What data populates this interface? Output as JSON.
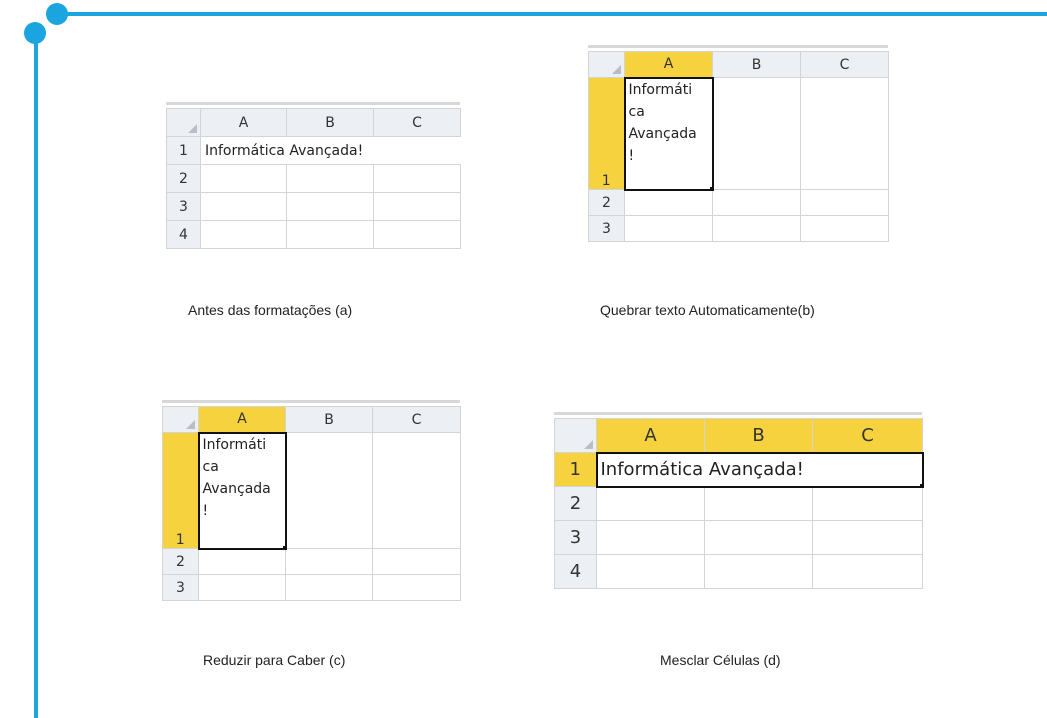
{
  "colors": {
    "accent": "#1aa4e0",
    "selected_header": "#f6d23e",
    "header": "#eceff3"
  },
  "columns": [
    "A",
    "B",
    "C"
  ],
  "sheet_a": {
    "rows": [
      "1",
      "2",
      "3",
      "4"
    ],
    "cell_text": "Informática Avançada!",
    "caption": "Antes das formatações (a)"
  },
  "sheet_b": {
    "rows": [
      "1",
      "2",
      "3"
    ],
    "wrapped_lines": [
      "Informáti",
      "ca",
      "Avançada",
      "!"
    ],
    "caption": "Quebrar texto Automaticamente(b)"
  },
  "sheet_c": {
    "rows": [
      "1",
      "2",
      "3"
    ],
    "wrapped_lines": [
      "Informáti",
      "ca",
      "Avançada",
      "!"
    ],
    "caption": "Reduzir para Caber (c)"
  },
  "sheet_d": {
    "rows": [
      "1",
      "2",
      "3",
      "4"
    ],
    "cell_text": "Informática Avançada!",
    "caption": "Mesclar Células (d)"
  }
}
